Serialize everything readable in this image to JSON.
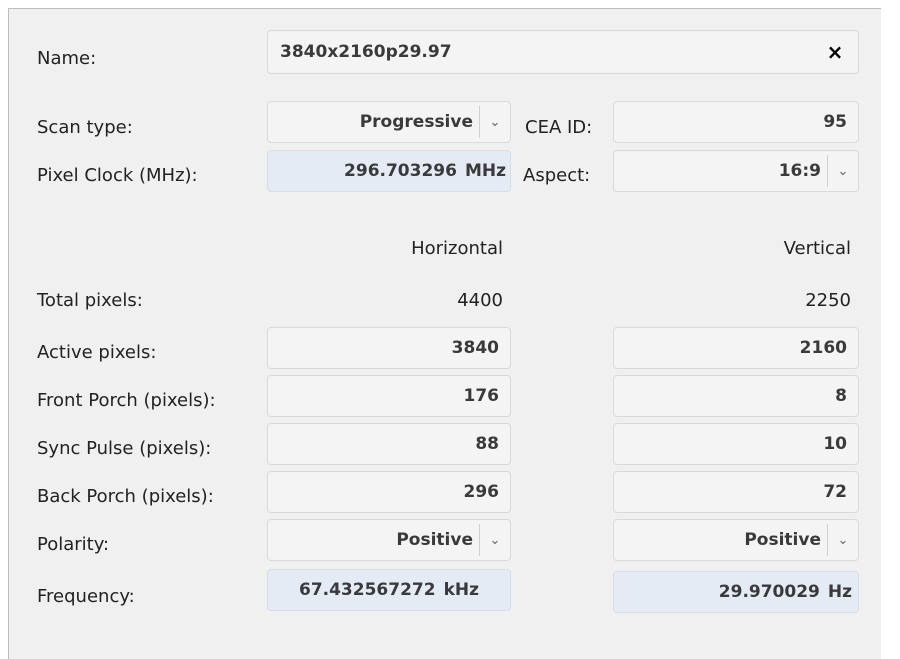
{
  "name": {
    "label": "Name:",
    "value": "3840x2160p29.97",
    "clear_icon": "×"
  },
  "scan_type": {
    "label": "Scan type:",
    "value": "Progressive"
  },
  "cea_id": {
    "label": "CEA ID:",
    "value": "95"
  },
  "pixel_clock": {
    "label": "Pixel Clock (MHz):",
    "value": "296.703296",
    "unit": "MHz"
  },
  "aspect": {
    "label": "Aspect:",
    "value": "16:9"
  },
  "columns": {
    "horizontal": "Horizontal",
    "vertical": "Vertical"
  },
  "total_pixels": {
    "label": "Total pixels:",
    "horizontal": "4400",
    "vertical": "2250"
  },
  "active_pixels": {
    "label": "Active pixels:",
    "horizontal": "3840",
    "vertical": "2160"
  },
  "front_porch": {
    "label": "Front Porch (pixels):",
    "horizontal": "176",
    "vertical": "8"
  },
  "sync_pulse": {
    "label": "Sync Pulse (pixels):",
    "horizontal": "88",
    "vertical": "10"
  },
  "back_porch": {
    "label": "Back Porch (pixels):",
    "horizontal": "296",
    "vertical": "72"
  },
  "polarity": {
    "label": "Polarity:",
    "horizontal": "Positive",
    "vertical": "Positive"
  },
  "frequency": {
    "label": "Frequency:",
    "horizontal_value": "67.432567272",
    "horizontal_unit": "kHz",
    "vertical_value": "29.970029",
    "vertical_unit": "Hz"
  },
  "chevron_glyph": "⌄",
  "colors": {
    "panel_bg": "#f0f0f0",
    "readonly_field_bg": "#e4ebf5",
    "field_bg": "#f4f4f4"
  }
}
